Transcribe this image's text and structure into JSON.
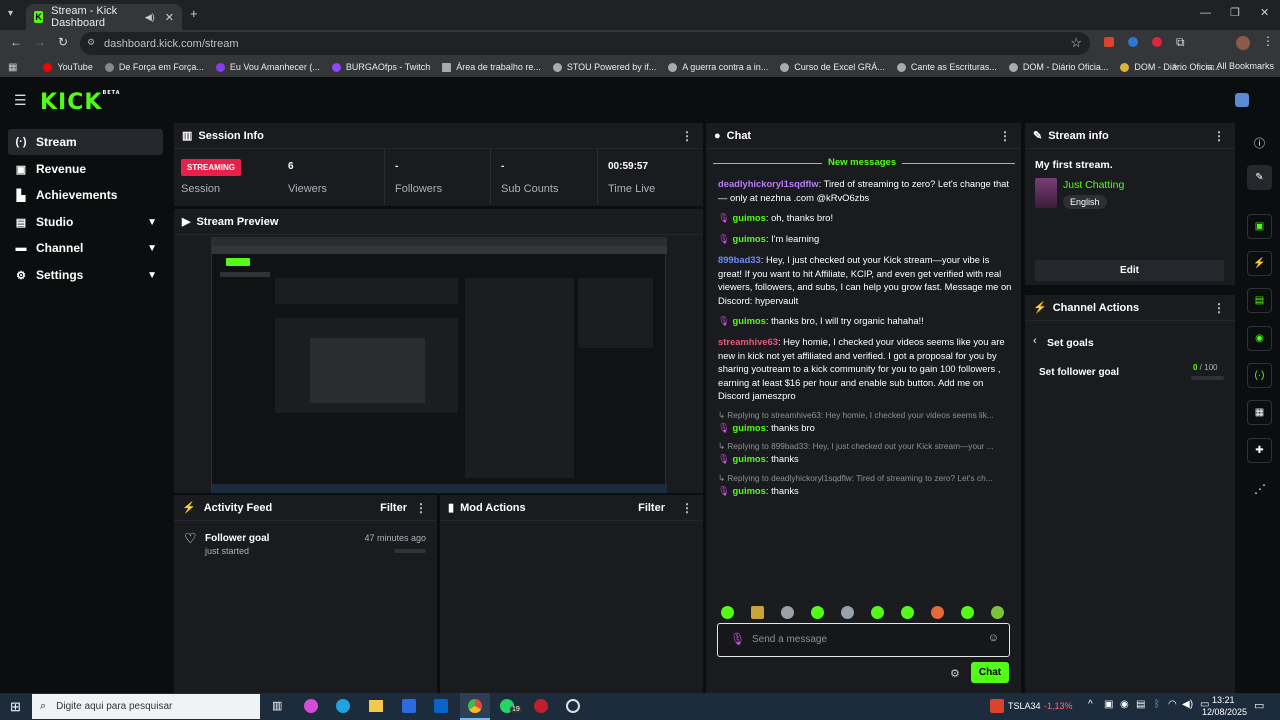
{
  "browser": {
    "tab_title": "Stream - Kick Dashboard",
    "url": "dashboard.kick.com/stream",
    "bookmarks": [
      "YouTube",
      "De Força em Força...",
      "Eu Vou Amanhecer (...",
      "BURGAOfps - Twitch",
      "Área de trabalho re...",
      "STOU Powered by if...",
      "A guerra contra a in...",
      "Curso de Excel GRÁ...",
      "Cante as Escrituras...",
      "DOM - Diário Oficia...",
      "DOM - Diário Oficia..."
    ],
    "all_bookmarks": "All Bookmarks"
  },
  "logo": "KICK",
  "logo_sup": "BETA",
  "sidebar": {
    "items": [
      {
        "label": "Stream",
        "icon": "broadcast-icon"
      },
      {
        "label": "Revenue",
        "icon": "revenue-icon"
      },
      {
        "label": "Achievements",
        "icon": "trophy-icon"
      },
      {
        "label": "Studio",
        "icon": "studio-icon"
      },
      {
        "label": "Channel",
        "icon": "channel-icon"
      },
      {
        "label": "Settings",
        "icon": "gear-icon"
      }
    ]
  },
  "session": {
    "title": "Session Info",
    "badge": "STREAMING",
    "badge_label": "Session",
    "stats": [
      {
        "value": "6",
        "label": "Viewers"
      },
      {
        "value": "-",
        "label": "Followers"
      },
      {
        "value": "-",
        "label": "Sub Counts"
      },
      {
        "value": "00:59:57",
        "label": "Time Live"
      }
    ]
  },
  "preview": {
    "title": "Stream Preview"
  },
  "activity": {
    "title": "Activity Feed",
    "filter": "Filter",
    "item_title": "Follower goal",
    "item_sub": "just started",
    "item_time": "47 minutes ago"
  },
  "mod": {
    "title": "Mod Actions",
    "filter": "Filter"
  },
  "chat": {
    "title": "Chat",
    "new_messages": "New messages",
    "placeholder": "Send a message",
    "send": "Chat",
    "m1_user": "deadlyhickoryl1sqdflw",
    "m1_text": ": Tired of streaming to zero? Let's change that — only at nezhna .com @kRvO6zbs",
    "m2_user": "guimos",
    "m2_text": ": oh, thanks bro!",
    "m3_user": "guimos",
    "m3_text": ": I'm learning",
    "m4_user": "899bad33",
    "m4_text": ": Hey, I just checked out your Kick stream—your vibe is great! If you want to hit Affiliate, KCIP, and even get verified with real viewers, followers, and subs, I can help you grow fast. Message me on Discord: hypervault",
    "m5_user": "guimos",
    "m5_text": ": thanks bro, I will try organic hahaha!!",
    "m6_user": "streamhive63",
    "m6_text": ": Hey homie, I checked your videos seems like you are new in kick not yet affiliated and verified. I got a proposal for you by sharing youtream to a kick community for you to gain 100 followers , earning at least $16 per hour and enable sub button. Add me on Discord jameszpro",
    "r1": "Replying to streamhive63: Hey homie, I checked your videos seems lik...",
    "m7_user": "guimos",
    "m7_text": ": thanks bro",
    "r2": "Replying to 899bad33: Hey, I just checked out your Kick stream—your ...",
    "m8_user": "guimos",
    "m8_text": ": thanks",
    "r3": "Replying to deadlyhickoryl1sqdflw: Tired of streaming to zero? Let's ch...",
    "m9_user": "guimos",
    "m9_text": ": thanks"
  },
  "streaminfo": {
    "title": "Stream info",
    "stream_title": "My first stream.",
    "category": "Just Chatting",
    "language": "English",
    "edit": "Edit"
  },
  "channel_actions": {
    "title": "Channel Actions",
    "set_goals": "Set goals",
    "goal_label": "Set follower goal",
    "goal_current": "0",
    "goal_total": " / 100"
  },
  "taskbar": {
    "search": "Digite aqui para pesquisar",
    "ticker": "TSLA34",
    "change": "-1,13%",
    "time": "13:21",
    "date": "12/08/2025",
    "badge": "19"
  },
  "colors": {
    "accent": "#53fc18",
    "streaming_badge": "#e8204a",
    "panel": "#191b1f",
    "bg": "#0b0e0f"
  }
}
